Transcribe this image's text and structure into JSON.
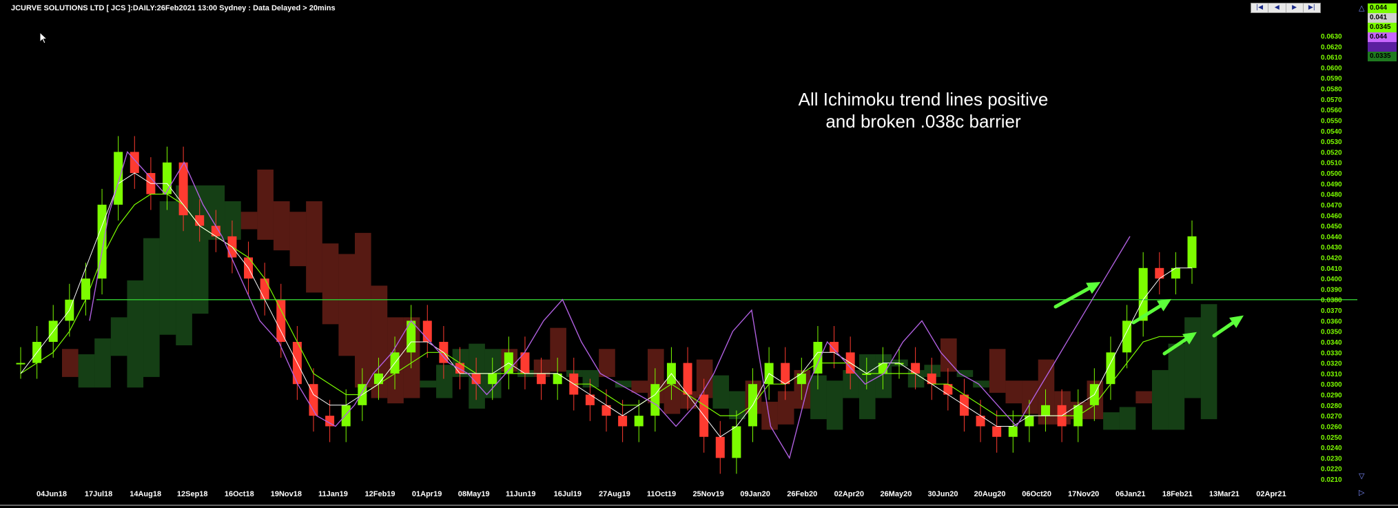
{
  "header": {
    "title": "JCURVE SOLUTIONS LTD [ JCS ]:DAILY:26Feb2021 13:00 Sydney : Data Delayed > 20mins"
  },
  "nav": {
    "first": "|◀",
    "prev": "◀",
    "next": "▶",
    "last": "▶|"
  },
  "annotation": {
    "line1": "All Ichimoku trend lines positive",
    "line2": "and broken .038c barrier"
  },
  "side_labels": [
    {
      "text": "0.044",
      "bg": "#7cfc00"
    },
    {
      "text": "0.041",
      "bg": "#d0d0d0"
    },
    {
      "text": "0.0345",
      "bg": "#7cfc00"
    },
    {
      "text": "0.044",
      "bg": "#c866ff"
    },
    {
      "text": "",
      "bg": "#5a1fa0"
    },
    {
      "text": "0.0335",
      "bg": "#1f7a1f"
    }
  ],
  "icons": {
    "up": "triangle-up-icon",
    "down": "triangle-down-icon",
    "right": "triangle-right-icon"
  },
  "colors": {
    "up_candle": "#7cfc00",
    "down_candle": "#ff3b30",
    "chikou": "#b060e0",
    "tenkan": "#ffffff",
    "kijun": "#7cfc00",
    "cloud_bull": "#2e8b2e",
    "cloud_bear": "#c0392b"
  },
  "chart_data": {
    "type": "line",
    "y_ticks": [
      "0.0630",
      "0.0620",
      "0.0610",
      "0.0600",
      "0.0590",
      "0.0580",
      "0.0570",
      "0.0560",
      "0.0550",
      "0.0540",
      "0.0530",
      "0.0520",
      "0.0510",
      "0.0500",
      "0.0490",
      "0.0480",
      "0.0470",
      "0.0460",
      "0.0450",
      "0.0440",
      "0.0430",
      "0.0420",
      "0.0410",
      "0.0400",
      "0.0390",
      "0.0380",
      "0.0370",
      "0.0360",
      "0.0350",
      "0.0340",
      "0.0330",
      "0.0320",
      "0.0310",
      "0.0300",
      "0.0290",
      "0.0280",
      "0.0270",
      "0.0260",
      "0.0250",
      "0.0240",
      "0.0230",
      "0.0220",
      "0.0210"
    ],
    "x_ticks": [
      "04Jun18",
      "17Jul18",
      "14Aug18",
      "12Sep18",
      "16Oct18",
      "19Nov18",
      "11Jan19",
      "12Feb19",
      "01Apr19",
      "08May19",
      "11Jun19",
      "16Jul19",
      "27Aug19",
      "11Oct19",
      "25Nov19",
      "09Jan20",
      "26Feb20",
      "02Apr20",
      "26May20",
      "30Jun20",
      "20Aug20",
      "06Oct20",
      "17Nov20",
      "06Jan21",
      "18Feb21",
      "13Mar21",
      "02Apr21"
    ],
    "ylim": [
      0.021,
      0.063
    ],
    "barrier": 0.038,
    "close": [
      0.032,
      0.034,
      0.036,
      0.038,
      0.04,
      0.047,
      0.052,
      0.05,
      0.048,
      0.051,
      0.046,
      0.045,
      0.044,
      0.042,
      0.04,
      0.038,
      0.034,
      0.03,
      0.027,
      0.026,
      0.028,
      0.03,
      0.031,
      0.033,
      0.036,
      0.034,
      0.032,
      0.031,
      0.03,
      0.031,
      0.033,
      0.031,
      0.03,
      0.031,
      0.029,
      0.028,
      0.027,
      0.026,
      0.027,
      0.03,
      0.032,
      0.029,
      0.025,
      0.023,
      0.026,
      0.03,
      0.032,
      0.03,
      0.031,
      0.034,
      0.033,
      0.031,
      0.031,
      0.032,
      0.032,
      0.031,
      0.03,
      0.029,
      0.027,
      0.026,
      0.025,
      0.026,
      0.027,
      0.028,
      0.026,
      0.028,
      0.03,
      0.033,
      0.036,
      0.041,
      0.04,
      0.041,
      0.044
    ],
    "tenkan": [
      0.031,
      0.033,
      0.035,
      0.037,
      0.041,
      0.045,
      0.049,
      0.05,
      0.049,
      0.049,
      0.047,
      0.045,
      0.044,
      0.043,
      0.041,
      0.038,
      0.035,
      0.032,
      0.029,
      0.028,
      0.028,
      0.029,
      0.03,
      0.032,
      0.034,
      0.034,
      0.033,
      0.031,
      0.031,
      0.031,
      0.032,
      0.031,
      0.031,
      0.031,
      0.03,
      0.029,
      0.028,
      0.027,
      0.028,
      0.029,
      0.031,
      0.029,
      0.027,
      0.025,
      0.026,
      0.028,
      0.031,
      0.03,
      0.031,
      0.033,
      0.033,
      0.032,
      0.031,
      0.032,
      0.032,
      0.031,
      0.03,
      0.029,
      0.028,
      0.027,
      0.026,
      0.026,
      0.027,
      0.027,
      0.027,
      0.028,
      0.029,
      0.032,
      0.035,
      0.038,
      0.04,
      0.041,
      0.041
    ],
    "kijun": [
      0.031,
      0.032,
      0.033,
      0.035,
      0.038,
      0.042,
      0.045,
      0.047,
      0.048,
      0.048,
      0.047,
      0.045,
      0.044,
      0.043,
      0.042,
      0.04,
      0.037,
      0.034,
      0.031,
      0.03,
      0.029,
      0.029,
      0.03,
      0.031,
      0.032,
      0.033,
      0.033,
      0.032,
      0.031,
      0.031,
      0.031,
      0.031,
      0.031,
      0.031,
      0.03,
      0.03,
      0.029,
      0.028,
      0.028,
      0.029,
      0.03,
      0.029,
      0.028,
      0.027,
      0.027,
      0.028,
      0.03,
      0.03,
      0.031,
      0.032,
      0.032,
      0.032,
      0.031,
      0.031,
      0.031,
      0.031,
      0.03,
      0.03,
      0.029,
      0.028,
      0.027,
      0.027,
      0.027,
      0.027,
      0.027,
      0.027,
      0.028,
      0.03,
      0.032,
      0.034,
      0.0345,
      0.0345,
      0.0345
    ],
    "chikou": [
      0.036,
      0.046,
      0.052,
      0.05,
      0.048,
      0.051,
      0.047,
      0.044,
      0.04,
      0.036,
      0.034,
      0.03,
      0.027,
      0.026,
      0.028,
      0.031,
      0.033,
      0.036,
      0.034,
      0.032,
      0.031,
      0.029,
      0.031,
      0.033,
      0.036,
      0.038,
      0.034,
      0.031,
      0.03,
      0.029,
      0.028,
      0.026,
      0.028,
      0.031,
      0.035,
      0.037,
      0.026,
      0.023,
      0.03,
      0.034,
      0.032,
      0.03,
      0.031,
      0.034,
      0.036,
      0.033,
      0.031,
      0.03,
      0.028,
      0.026,
      0.029,
      0.032,
      0.035,
      0.038,
      0.041,
      0.044
    ]
  }
}
